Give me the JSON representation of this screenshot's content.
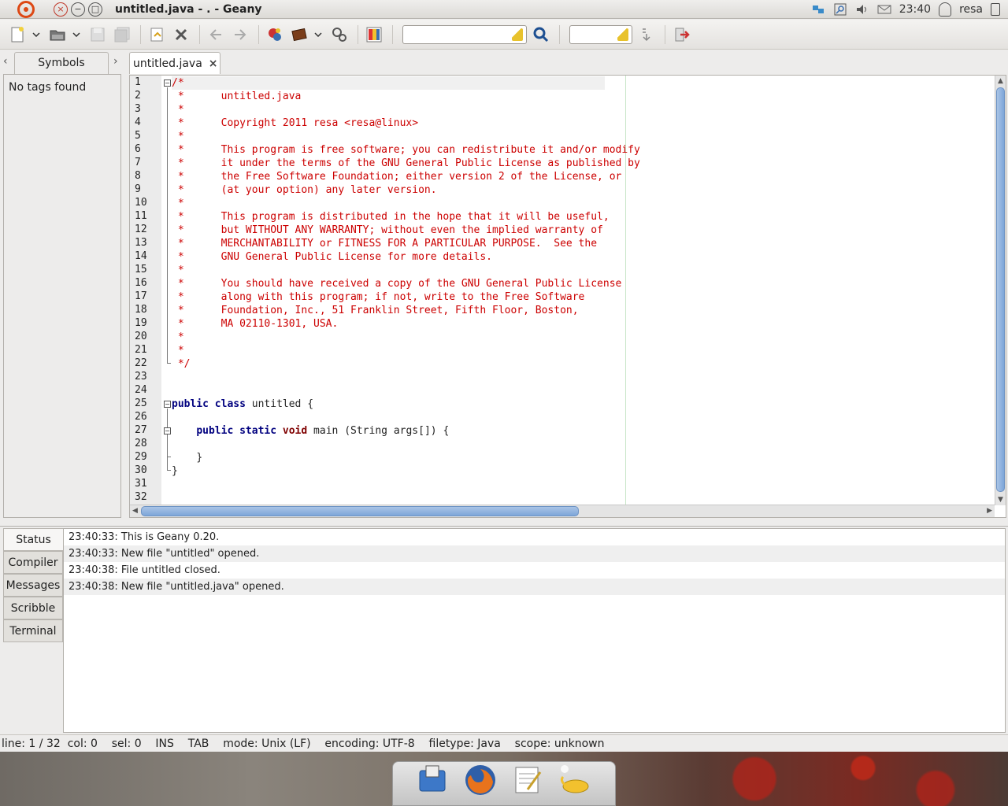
{
  "window": {
    "title": "untitled.java - . - Geany",
    "close_glyph": "×",
    "min_glyph": "−",
    "max_glyph": "□"
  },
  "tray": {
    "clock": "23:40",
    "user": "resa"
  },
  "sidebar": {
    "tab_label": "Symbols",
    "empty_text": "No tags found",
    "prev_glyph": "‹",
    "next_glyph": "›"
  },
  "editor": {
    "tab_label": "untitled.java",
    "tab_close": "×",
    "lines": [
      "/*",
      " *      untitled.java",
      " *      ",
      " *      Copyright 2011 resa <resa@linux>",
      " *      ",
      " *      This program is free software; you can redistribute it and/or modify",
      " *      it under the terms of the GNU General Public License as published by",
      " *      the Free Software Foundation; either version 2 of the License, or",
      " *      (at your option) any later version.",
      " *      ",
      " *      This program is distributed in the hope that it will be useful,",
      " *      but WITHOUT ANY WARRANTY; without even the implied warranty of",
      " *      MERCHANTABILITY or FITNESS FOR A PARTICULAR PURPOSE.  See the",
      " *      GNU General Public License for more details.",
      " *      ",
      " *      You should have received a copy of the GNU General Public License",
      " *      along with this program; if not, write to the Free Software",
      " *      Foundation, Inc., 51 Franklin Street, Fifth Floor, Boston,",
      " *      MA 02110-1301, USA.",
      " *      ",
      " *      ",
      " */",
      "",
      "",
      "public class untitled {",
      "",
      "    public static void main (String args[]) {",
      "",
      "    }",
      "}",
      "",
      ""
    ],
    "line_numbers": [
      "1",
      "2",
      "3",
      "4",
      "5",
      "6",
      "7",
      "8",
      "9",
      "10",
      "11",
      "12",
      "13",
      "14",
      "15",
      "16",
      "17",
      "18",
      "19",
      "20",
      "21",
      "22",
      "23",
      "24",
      "25",
      "26",
      "27",
      "28",
      "29",
      "30",
      "31",
      "32"
    ]
  },
  "messages": {
    "tabs": [
      "Status",
      "Compiler",
      "Messages",
      "Scribble",
      "Terminal"
    ],
    "rows": [
      "23:40:33: This is Geany 0.20.",
      "23:40:33: New file \"untitled\" opened.",
      "23:40:38: File untitled closed.",
      "23:40:38: New file \"untitled.java\" opened."
    ]
  },
  "statusbar": {
    "line": "line: 1 / 32",
    "col": "col: 0",
    "sel": "sel: 0",
    "ins": "INS",
    "tab": "TAB",
    "mode": "mode: Unix (LF)",
    "encoding": "encoding: UTF-8",
    "filetype": "filetype: Java",
    "scope": "scope: unknown"
  },
  "colors": {
    "comment": "#cc0000",
    "keyword": "#00007f",
    "type_keyword": "#7f0000",
    "scroll_thumb": "#7ea6d9"
  },
  "icons": [
    "ubuntu-logo-icon",
    "new-file-icon",
    "open-file-icon",
    "save-icon",
    "save-all-icon",
    "revert-icon",
    "close-file-icon",
    "back-icon",
    "forward-icon",
    "compile-icon",
    "build-icon",
    "execute-icon",
    "color-chooser-icon",
    "search-icon",
    "jump-line-icon",
    "quit-icon"
  ]
}
